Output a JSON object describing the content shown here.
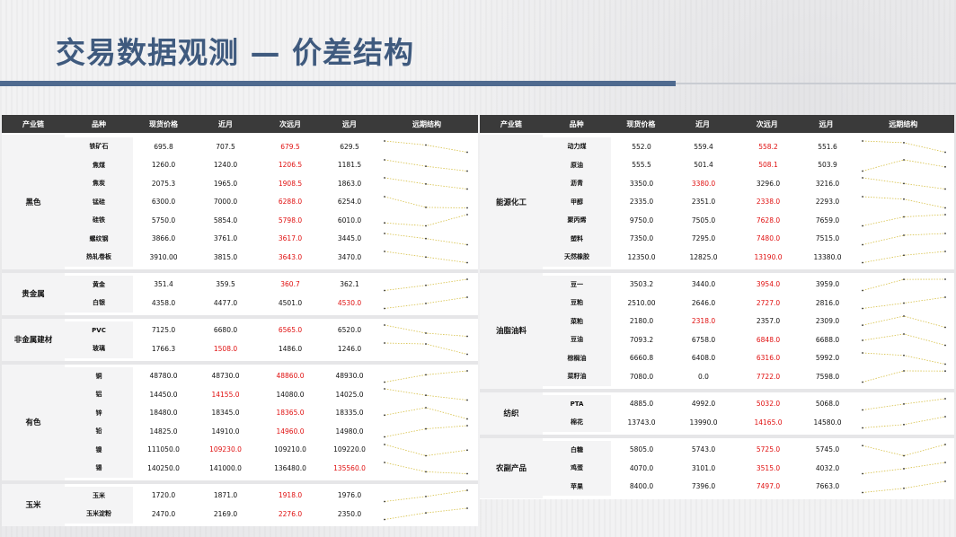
{
  "title": "交易数据观测 — 价差结构",
  "headers": [
    "产业链",
    "品种",
    "现货价格",
    "近月",
    "次远月",
    "远月",
    "远期结构"
  ],
  "left_groups": [
    {
      "name": "黑色",
      "rows": [
        {
          "name": "铁矿石",
          "spot": "695.8",
          "near": "707.5",
          "next": "679.5",
          "far": "629.5",
          "red": 2
        },
        {
          "name": "焦煤",
          "spot": "1260.0",
          "near": "1240.0",
          "next": "1206.5",
          "far": "1181.5",
          "red": 2
        },
        {
          "name": "焦炭",
          "spot": "2075.3",
          "near": "1965.0",
          "next": "1908.5",
          "far": "1863.0",
          "red": 2
        },
        {
          "name": "锰硅",
          "spot": "6300.0",
          "near": "7000.0",
          "next": "6288.0",
          "far": "6254.0",
          "red": 2
        },
        {
          "name": "硅铁",
          "spot": "5750.0",
          "near": "5854.0",
          "next": "5798.0",
          "far": "6010.0",
          "red": 2
        },
        {
          "name": "螺纹钢",
          "spot": "3866.0",
          "near": "3761.0",
          "next": "3617.0",
          "far": "3445.0",
          "red": 2
        },
        {
          "name": "热轧卷板",
          "spot": "3910.00",
          "near": "3815.0",
          "next": "3643.0",
          "far": "3470.0",
          "red": 2
        }
      ]
    },
    {
      "name": "贵金属",
      "rows": [
        {
          "name": "黄金",
          "spot": "351.4",
          "near": "359.5",
          "next": "360.7",
          "far": "362.1",
          "red": 2
        },
        {
          "name": "白银",
          "spot": "4358.0",
          "near": "4477.0",
          "next": "4501.0",
          "far": "4530.0",
          "red": 3
        }
      ]
    },
    {
      "name": "非金属建材",
      "rows": [
        {
          "name": "PVC",
          "spot": "7125.0",
          "near": "6680.0",
          "next": "6565.0",
          "far": "6520.0",
          "red": 2
        },
        {
          "name": "玻璃",
          "spot": "1766.3",
          "near": "1508.0",
          "next": "1486.0",
          "far": "1246.0",
          "red": 1
        }
      ]
    },
    {
      "name": "有色",
      "rows": [
        {
          "name": "铜",
          "spot": "48780.0",
          "near": "48730.0",
          "next": "48860.0",
          "far": "48930.0",
          "red": 2
        },
        {
          "name": "铝",
          "spot": "14450.0",
          "near": "14155.0",
          "next": "14080.0",
          "far": "14025.0",
          "red": 1
        },
        {
          "name": "锌",
          "spot": "18480.0",
          "near": "18345.0",
          "next": "18365.0",
          "far": "18335.0",
          "red": 2
        },
        {
          "name": "铅",
          "spot": "14825.0",
          "near": "14910.0",
          "next": "14960.0",
          "far": "14980.0",
          "red": 2
        },
        {
          "name": "镍",
          "spot": "111050.0",
          "near": "109230.0",
          "next": "109210.0",
          "far": "109220.0",
          "red": 1
        },
        {
          "name": "锡",
          "spot": "140250.0",
          "near": "141000.0",
          "next": "136480.0",
          "far": "135560.0",
          "red": 3
        }
      ]
    },
    {
      "name": "玉米",
      "rows": [
        {
          "name": "玉米",
          "spot": "1720.0",
          "near": "1871.0",
          "next": "1918.0",
          "far": "1976.0",
          "red": 2
        },
        {
          "name": "玉米淀粉",
          "spot": "2470.0",
          "near": "2169.0",
          "next": "2276.0",
          "far": "2350.0",
          "red": 2
        }
      ]
    }
  ],
  "right_groups": [
    {
      "name": "能源化工",
      "rows": [
        {
          "name": "动力煤",
          "spot": "552.0",
          "near": "559.4",
          "next": "558.2",
          "far": "551.6",
          "red": 2
        },
        {
          "name": "原油",
          "spot": "555.5",
          "near": "501.4",
          "next": "508.1",
          "far": "503.9",
          "red": 2
        },
        {
          "name": "沥青",
          "spot": "3350.0",
          "near": "3380.0",
          "next": "3296.0",
          "far": "3216.0",
          "red": 1
        },
        {
          "name": "甲醇",
          "spot": "2335.0",
          "near": "2351.0",
          "next": "2338.0",
          "far": "2293.0",
          "red": 2
        },
        {
          "name": "聚丙烯",
          "spot": "9750.0",
          "near": "7505.0",
          "next": "7628.0",
          "far": "7659.0",
          "red": 2
        },
        {
          "name": "塑料",
          "spot": "7350.0",
          "near": "7295.0",
          "next": "7480.0",
          "far": "7515.0",
          "red": 2
        },
        {
          "name": "天然橡胶",
          "spot": "12350.0",
          "near": "12825.0",
          "next": "13190.0",
          "far": "13380.0",
          "red": 2
        }
      ]
    },
    {
      "name": "油脂油料",
      "rows": [
        {
          "name": "豆一",
          "spot": "3503.2",
          "near": "3440.0",
          "next": "3954.0",
          "far": "3959.0",
          "red": 2
        },
        {
          "name": "豆粕",
          "spot": "2510.00",
          "near": "2646.0",
          "next": "2727.0",
          "far": "2816.0",
          "red": 2
        },
        {
          "name": "菜粕",
          "spot": "2180.0",
          "near": "2318.0",
          "next": "2357.0",
          "far": "2309.0",
          "red": 1
        },
        {
          "name": "豆油",
          "spot": "7093.2",
          "near": "6758.0",
          "next": "6848.0",
          "far": "6688.0",
          "red": 2
        },
        {
          "name": "棕榈油",
          "spot": "6660.8",
          "near": "6408.0",
          "next": "6316.0",
          "far": "5992.0",
          "red": 2
        },
        {
          "name": "菜籽油",
          "spot": "7080.0",
          "near": "0.0",
          "next": "7722.0",
          "far": "7598.0",
          "red": 2
        }
      ]
    },
    {
      "name": "纺织",
      "rows": [
        {
          "name": "PTA",
          "spot": "4885.0",
          "near": "4992.0",
          "next": "5032.0",
          "far": "5068.0",
          "red": 2
        },
        {
          "name": "棉花",
          "spot": "13743.0",
          "near": "13990.0",
          "next": "14165.0",
          "far": "14580.0",
          "red": 2
        }
      ]
    },
    {
      "name": "农副产品",
      "rows": [
        {
          "name": "白糖",
          "spot": "5805.0",
          "near": "5743.0",
          "next": "5725.0",
          "far": "5745.0",
          "red": 2
        },
        {
          "name": "鸡蛋",
          "spot": "4070.0",
          "near": "3101.0",
          "next": "3515.0",
          "far": "4032.0",
          "red": 2
        },
        {
          "name": "苹果",
          "spot": "8400.0",
          "near": "7396.0",
          "next": "7497.0",
          "far": "7663.0",
          "red": 2
        }
      ]
    }
  ]
}
